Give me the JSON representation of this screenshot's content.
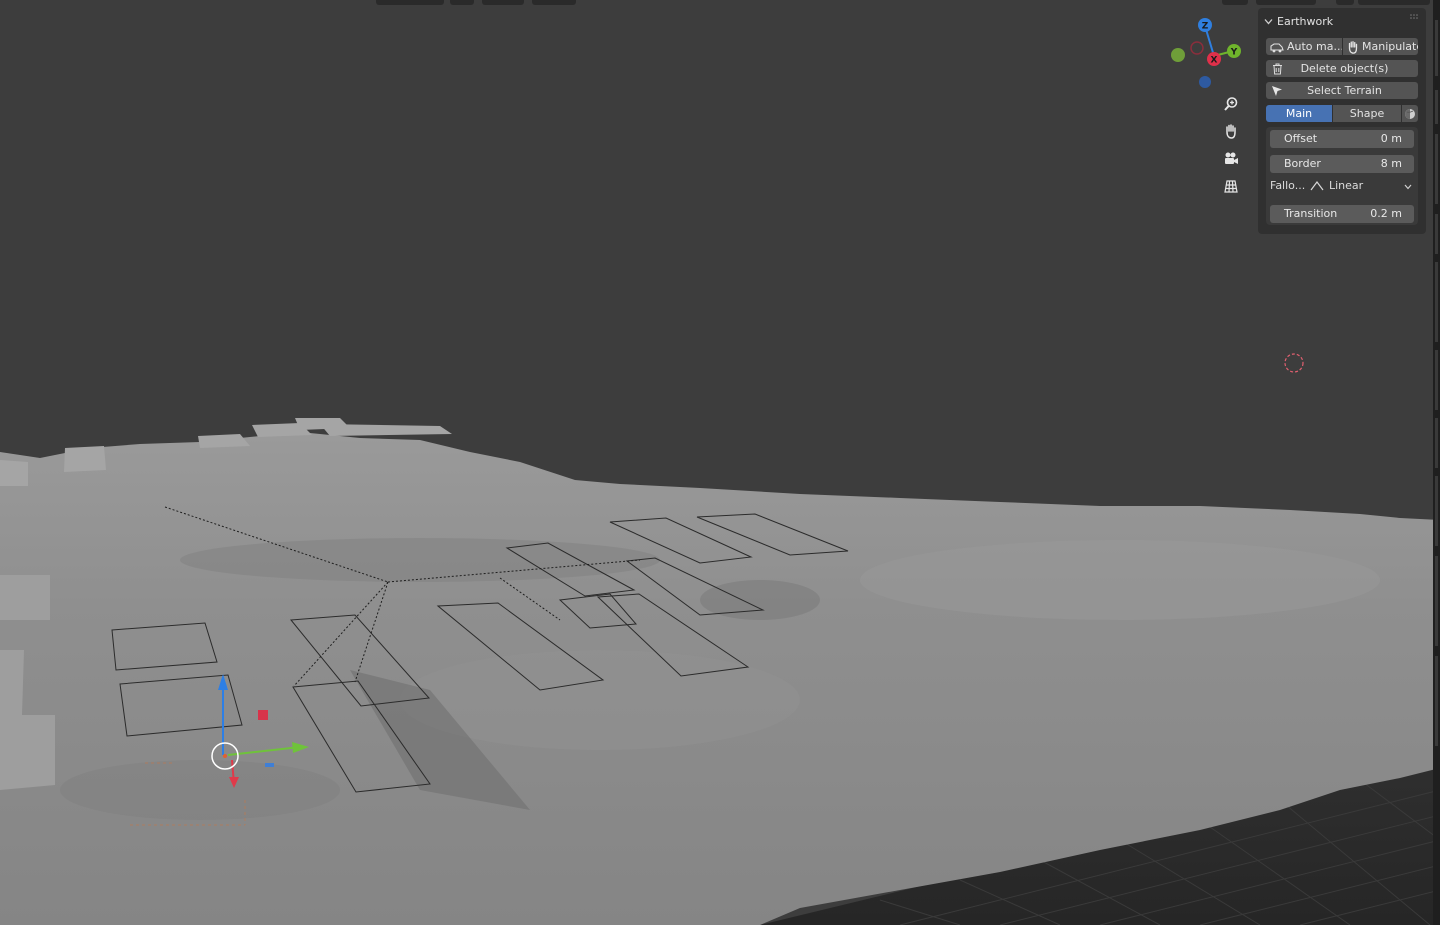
{
  "sidebar": {
    "panel_title": "Earthwork",
    "auto_button_label": "Auto ma...",
    "manipulate_button_label": "Manipulate",
    "delete_button_label": "Delete object(s)",
    "select_terrain_label": "Select Terrain",
    "tabs": [
      {
        "label": "Main",
        "active": true
      },
      {
        "label": "Shape",
        "active": false
      }
    ],
    "fields": {
      "offset_label": "Offset",
      "offset_value": "0 m",
      "border_label": "Border",
      "border_value": "8 m",
      "falloff_label": "Fallo...",
      "falloff_value": "Linear",
      "transition_label": "Transition",
      "transition_value": "0.2 m"
    }
  },
  "gizmo": {
    "axes": [
      {
        "label": "Z",
        "color": "#2f7fe0"
      },
      {
        "label": "Y",
        "color": "#6fb42c"
      },
      {
        "label": "X",
        "color": "#e0304a"
      }
    ]
  },
  "nav_buttons": [
    "zoom-icon",
    "hand-pan-icon",
    "camera-icon",
    "grid-view-icon"
  ],
  "theme": {
    "background": "#3d3d3d",
    "panel": "#303030",
    "accent": "#4772b3",
    "terrain": "#8e8e8e"
  }
}
